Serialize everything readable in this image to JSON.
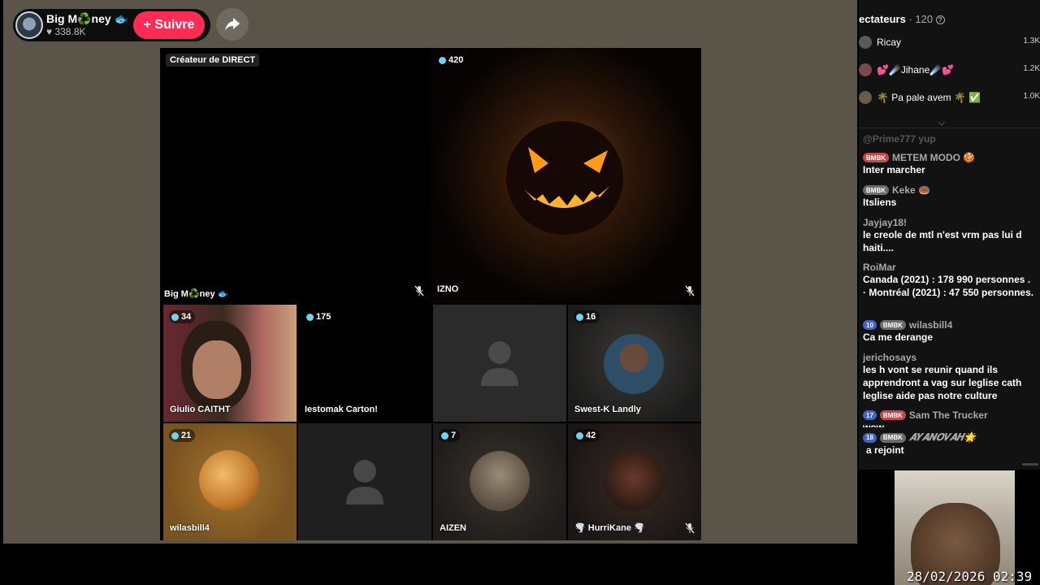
{
  "host": {
    "name": "Big M♻️ney 🐟",
    "likes": "♥ 338.8K",
    "follow_label": "+ Suivre"
  },
  "grid": {
    "creator_label": "Créateur de DIRECT",
    "tiles": [
      {
        "id": "host",
        "label": "Big M♻️ney 🐟",
        "count": null
      },
      {
        "id": "izno",
        "label": "IZNO",
        "count": "420"
      },
      {
        "id": "giulio",
        "label": "Giulio CAITHT",
        "count": "34"
      },
      {
        "id": "iestomak",
        "label": "Iestomak Carton!",
        "count": "175"
      },
      {
        "id": "empty1",
        "label": "",
        "count": null
      },
      {
        "id": "swestk",
        "label": "Swest-K Landly",
        "count": "16"
      },
      {
        "id": "wilasbill",
        "label": "wilasbill4",
        "count": "21"
      },
      {
        "id": "empty2",
        "label": "",
        "count": null
      },
      {
        "id": "aizen",
        "label": "AIZEN",
        "count": "7"
      },
      {
        "id": "hurrikane",
        "label": "🌪️ HurriKane 🌪️",
        "count": "42"
      }
    ]
  },
  "panel": {
    "viewers_title": "ectateurs",
    "viewers_count": "· 120",
    "viewers": [
      {
        "name": "Ricay",
        "score": "1.3K"
      },
      {
        "name": "💕☄️Jihane☄️💕",
        "score": "1.2K"
      },
      {
        "name": "🌴 Pa pale avem 🌴 ✅",
        "score": "1.0K"
      }
    ],
    "chat": [
      {
        "user": "@Prime777 yup",
        "tags": [],
        "text": ""
      },
      {
        "user": "METEM MODO 🍪",
        "tags": [
          {
            "t": "BMBK",
            "c": "red"
          }
        ],
        "text": "Inter marcher"
      },
      {
        "user": "Keke 🍩",
        "tags": [
          {
            "t": "BMBK",
            "c": "grey"
          }
        ],
        "text": "Itsliens"
      },
      {
        "user": "Jayjay18!",
        "tags": [],
        "text": "le creole de mtl n'est vrm pas lui d haiti...."
      },
      {
        "user": "RoiMar",
        "tags": [],
        "text": "Canada (2021) : 178 990 personnes . · Montréal (2021) : 47 550 personnes."
      },
      {
        "user": "wilasbill4",
        "tags": [
          {
            "t": "10",
            "c": "blue"
          },
          {
            "t": "BMBK",
            "c": "grey"
          }
        ],
        "text": "Ca me derange"
      },
      {
        "user": "jerichosays",
        "tags": [],
        "text": "les h vont se reunir quand ils apprendront a vag sur leglise cath leglise aide pas notre culture"
      },
      {
        "user": "Sam The Trucker",
        "tags": [
          {
            "t": "17",
            "c": "blue"
          },
          {
            "t": "BMBK",
            "c": "red"
          }
        ],
        "text": "wow"
      },
      {
        "user": "𝑨𝒀𝑨𝑵𝑶𝑽𝑨𝑯🌟",
        "tags": [
          {
            "t": "18",
            "c": "blue"
          },
          {
            "t": "BMBK",
            "c": "grey"
          }
        ],
        "text": "a rejoint"
      }
    ]
  },
  "overlay": {
    "timestamp": "28/02/2026 02:39"
  },
  "colors": {
    "follow": "#fe2c55",
    "background": "#5b5549",
    "panel": "#121212"
  }
}
